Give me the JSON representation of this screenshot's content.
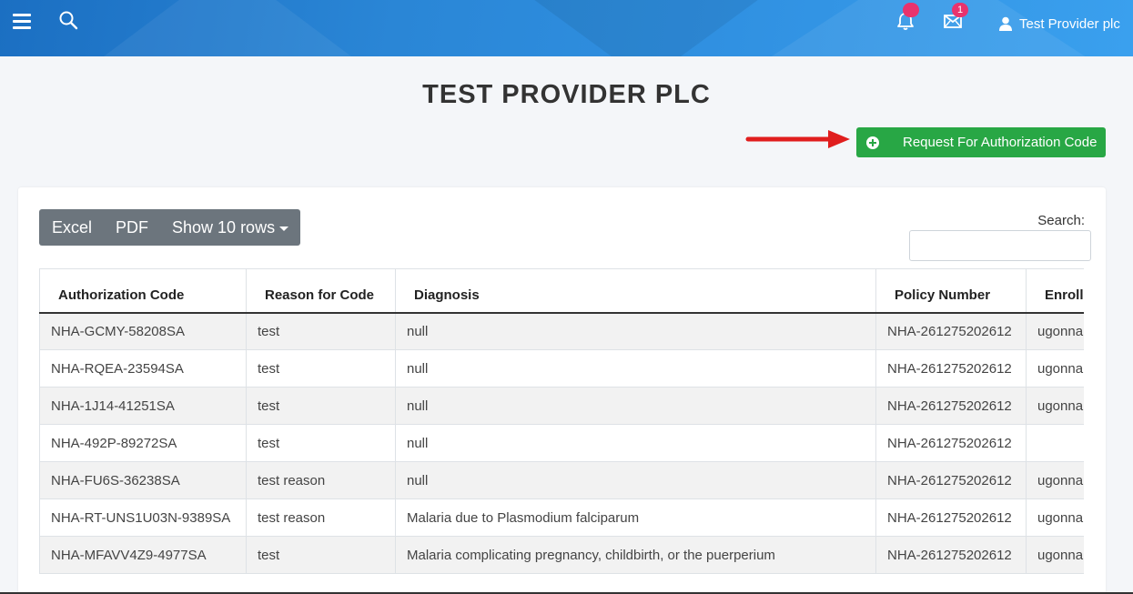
{
  "header": {
    "notifications_badge": "",
    "messages_badge": "1",
    "user_name": "Test Provider plc"
  },
  "page": {
    "title": "TEST PROVIDER PLC",
    "request_button_label": "Request For Authorization Code"
  },
  "table_controls": {
    "excel_label": "Excel",
    "pdf_label": "PDF",
    "rows_label": "Show 10 rows",
    "search_label": "Search:",
    "search_value": ""
  },
  "table": {
    "columns": [
      "Authorization Code",
      "Reason for Code",
      "Diagnosis",
      "Policy Number",
      "Enroll"
    ],
    "rows": [
      [
        "NHA-GCMY-58208SA",
        "test",
        "null",
        "NHA-261275202612",
        "ugonna"
      ],
      [
        "NHA-RQEA-23594SA",
        "test",
        "null",
        "NHA-261275202612",
        "ugonna"
      ],
      [
        "NHA-1J14-41251SA",
        "test",
        "null",
        "NHA-261275202612",
        "ugonna"
      ],
      [
        "NHA-492P-89272SA",
        "test",
        "null",
        "NHA-261275202612",
        ""
      ],
      [
        "NHA-FU6S-36238SA",
        "test reason",
        "null",
        "NHA-261275202612",
        "ugonna"
      ],
      [
        "NHA-RT-UNS1U03N-9389SA",
        "test reason",
        "Malaria due to Plasmodium falciparum",
        "NHA-261275202612",
        "ugonna"
      ],
      [
        "NHA-MFAVV4Z9-4977SA",
        "test",
        "Malaria complicating pregnancy, childbirth, or the puerperium",
        "NHA-261275202612",
        "ugonna"
      ]
    ]
  }
}
